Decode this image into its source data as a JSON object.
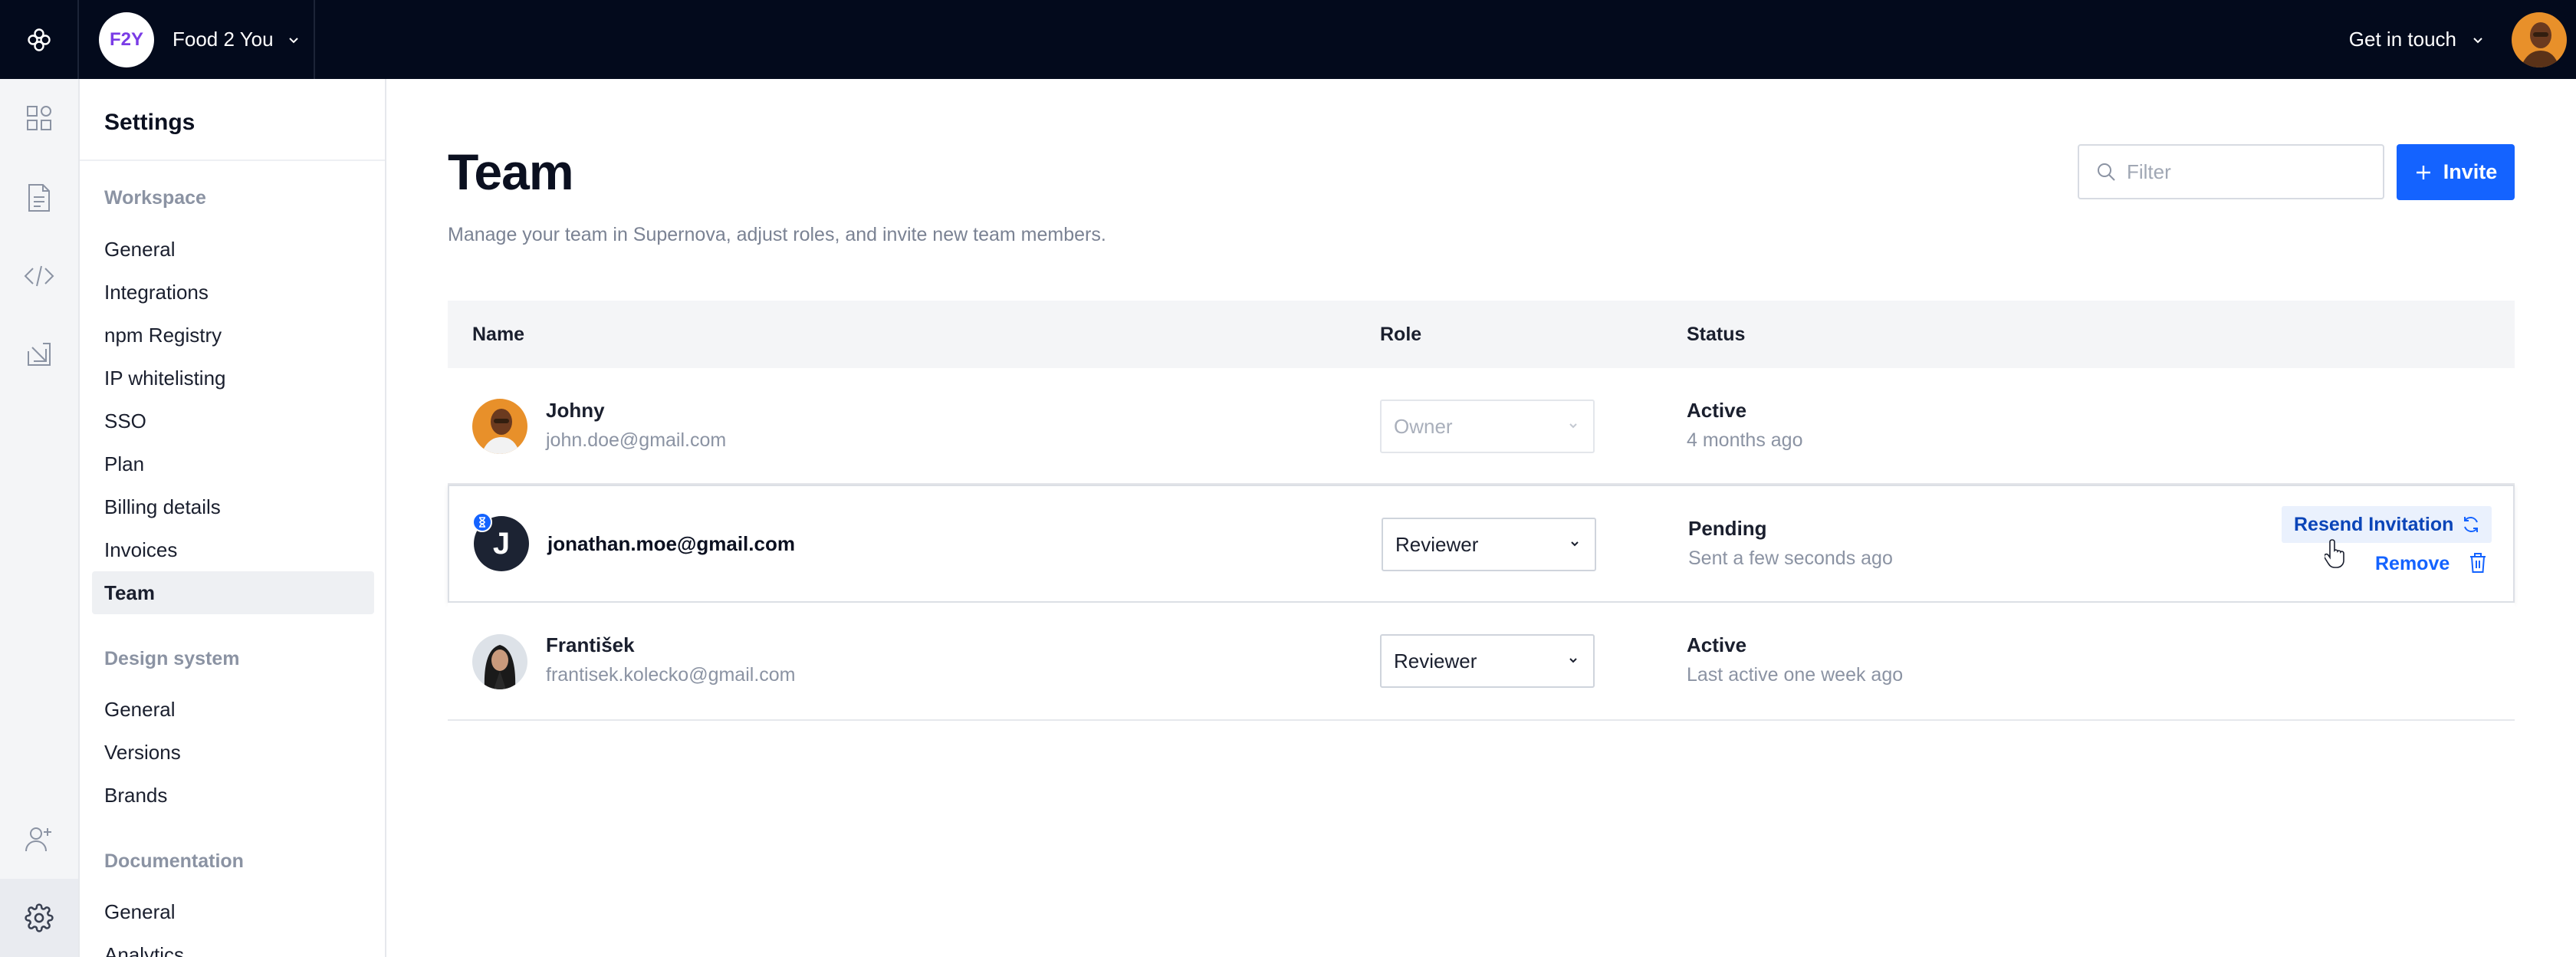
{
  "topbar": {
    "workspace_initials": "F2Y",
    "workspace_name": "Food 2 You",
    "get_in_touch": "Get in touch"
  },
  "sidebar": {
    "title": "Settings",
    "sections": [
      {
        "heading": "Workspace",
        "items": [
          "General",
          "Integrations",
          "npm Registry",
          "IP whitelisting",
          "SSO",
          "Plan",
          "Billing details",
          "Invoices",
          "Team"
        ]
      },
      {
        "heading": "Design system",
        "items": [
          "General",
          "Versions",
          "Brands"
        ]
      },
      {
        "heading": "Documentation",
        "items": [
          "General",
          "Analytics"
        ]
      }
    ],
    "active_item": "Team"
  },
  "main": {
    "title": "Team",
    "description": "Manage your team in Supernova, adjust roles, and invite new team members.",
    "filter_placeholder": "Filter",
    "invite_label": "Invite",
    "columns": [
      "Name",
      "Role",
      "Status"
    ],
    "rows": [
      {
        "name": "Johny",
        "email": "john.doe@gmail.com",
        "role": "Owner",
        "status": "Active",
        "status_detail": "4 months ago"
      },
      {
        "avatar_letter": "J",
        "email": "jonathan.moe@gmail.com",
        "role": "Reviewer",
        "status": "Pending",
        "status_detail": "Sent a few seconds ago",
        "resend_label": "Resend Invitation",
        "remove_label": "Remove"
      },
      {
        "name": "František",
        "email": "frantisek.kolecko@gmail.com",
        "role": "Reviewer",
        "status": "Active",
        "status_detail": "Last active one week ago"
      }
    ]
  },
  "colors": {
    "topbar_bg": "#030a1c",
    "accent": "#1463ff",
    "workspace_initials": "#7a3ce6"
  },
  "icons": [
    "supernova-logo-icon",
    "chevron-down-icon",
    "components-icon",
    "document-icon",
    "code-icon",
    "export-icon",
    "add-user-icon",
    "gear-icon",
    "search-icon",
    "plus-icon",
    "hourglass-icon",
    "refresh-icon",
    "trash-icon",
    "hand-cursor-icon"
  ]
}
